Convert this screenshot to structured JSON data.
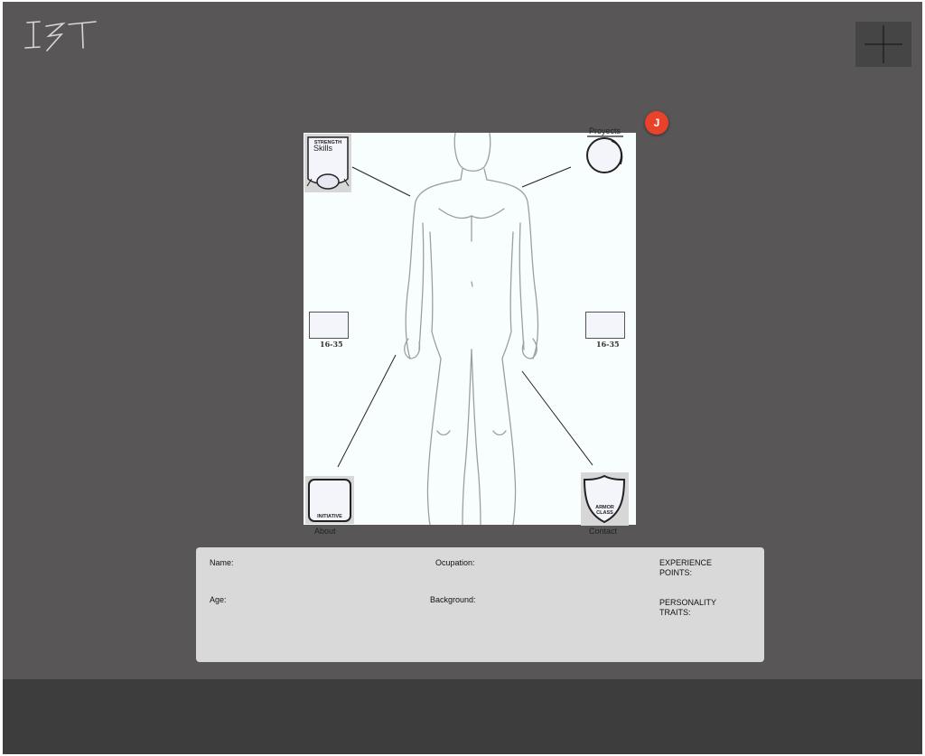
{
  "header": {
    "logo_text": "IST",
    "logo_icon": "handwritten-logo",
    "menu_icon": "plus-icon"
  },
  "notification": {
    "badge_letter": "J",
    "color": "#e8432a"
  },
  "sheet": {
    "skills": {
      "card_title": "STRENGTH",
      "label": "Skills"
    },
    "projects": {
      "label": "Proyects"
    },
    "left_box": {
      "label": "16-35"
    },
    "right_box": {
      "label": "16-35"
    },
    "about": {
      "card_title": "INITIATIVE",
      "label": "About"
    },
    "contact": {
      "card_title_1": "ARMOR",
      "card_title_2": "CLASS",
      "label": "Contact"
    }
  },
  "info_panel": {
    "name_label": "Name:",
    "occupation_label": "Ocupation:",
    "experience_label_1": "EXPERIENCE",
    "experience_label_2": "POINTS:",
    "age_label": "Age:",
    "background_label": "Background:",
    "personality_label_1": "PERSONALITY",
    "personality_label_2": "TRAITS:"
  },
  "colors": {
    "background": "#585657",
    "footer": "#3d3d3d",
    "sheet": "#f8fdfd",
    "panel": "#d9d9d9",
    "accent": "#e8432a"
  }
}
